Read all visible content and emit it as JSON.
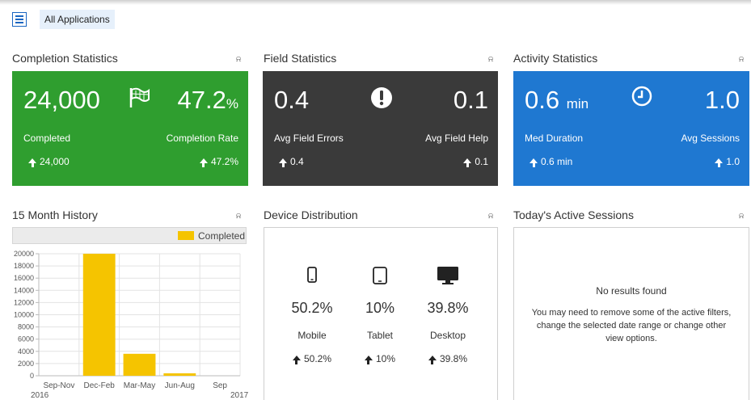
{
  "header": {
    "app_selector": "All Applications"
  },
  "completion": {
    "title": "Completion Statistics",
    "completed_value": "24,000",
    "completion_rate_value": "47.2",
    "completion_rate_unit": "%",
    "completed_label": "Completed",
    "completion_rate_label": "Completion Rate",
    "completed_trend": "24,000",
    "completion_rate_trend": "47.2%",
    "color": "#2f9e2f",
    "icon": "flag-icon"
  },
  "field": {
    "title": "Field Statistics",
    "errors_value": "0.4",
    "help_value": "0.1",
    "errors_label": "Avg Field Errors",
    "help_label": "Avg Field Help",
    "errors_trend": "0.4",
    "help_trend": "0.1",
    "color": "#3a3a3a",
    "icon": "exclamation-icon"
  },
  "activity": {
    "title": "Activity Statistics",
    "duration_value": "0.6",
    "duration_unit": "min",
    "sessions_value": "1.0",
    "duration_label": "Med Duration",
    "sessions_label": "Avg Sessions",
    "duration_trend": "0.6 min",
    "sessions_trend": "1.0",
    "color": "#1f78d1",
    "icon": "clock-icon"
  },
  "history": {
    "title": "15 Month History",
    "legend_label": "Completed"
  },
  "chart_data": {
    "type": "bar",
    "categories": [
      "Sep-Nov",
      "Dec-Feb",
      "Mar-May",
      "Jun-Aug",
      "Sep"
    ],
    "year_labels": [
      "2016",
      "2017"
    ],
    "series": [
      {
        "name": "Completed",
        "values": [
          0,
          20000,
          3600,
          400,
          0
        ],
        "color": "#f5c400"
      }
    ],
    "yticks": [
      0,
      2000,
      4000,
      6000,
      8000,
      10000,
      12000,
      14000,
      16000,
      18000,
      20000
    ],
    "ylim": [
      0,
      20000
    ],
    "grid": true,
    "legend": "top-right"
  },
  "devices": {
    "title": "Device Distribution",
    "items": [
      {
        "label": "Mobile",
        "pct": "50.2%",
        "trend": "50.2%",
        "icon": "mobile-icon"
      },
      {
        "label": "Tablet",
        "pct": "10%",
        "trend": "10%",
        "icon": "tablet-icon"
      },
      {
        "label": "Desktop",
        "pct": "39.8%",
        "trend": "39.8%",
        "icon": "desktop-icon"
      }
    ]
  },
  "sessions": {
    "title": "Today's Active Sessions",
    "empty_title": "No results found",
    "empty_message": "You may need to remove some of the active filters, change the selected date range or change other view options."
  }
}
